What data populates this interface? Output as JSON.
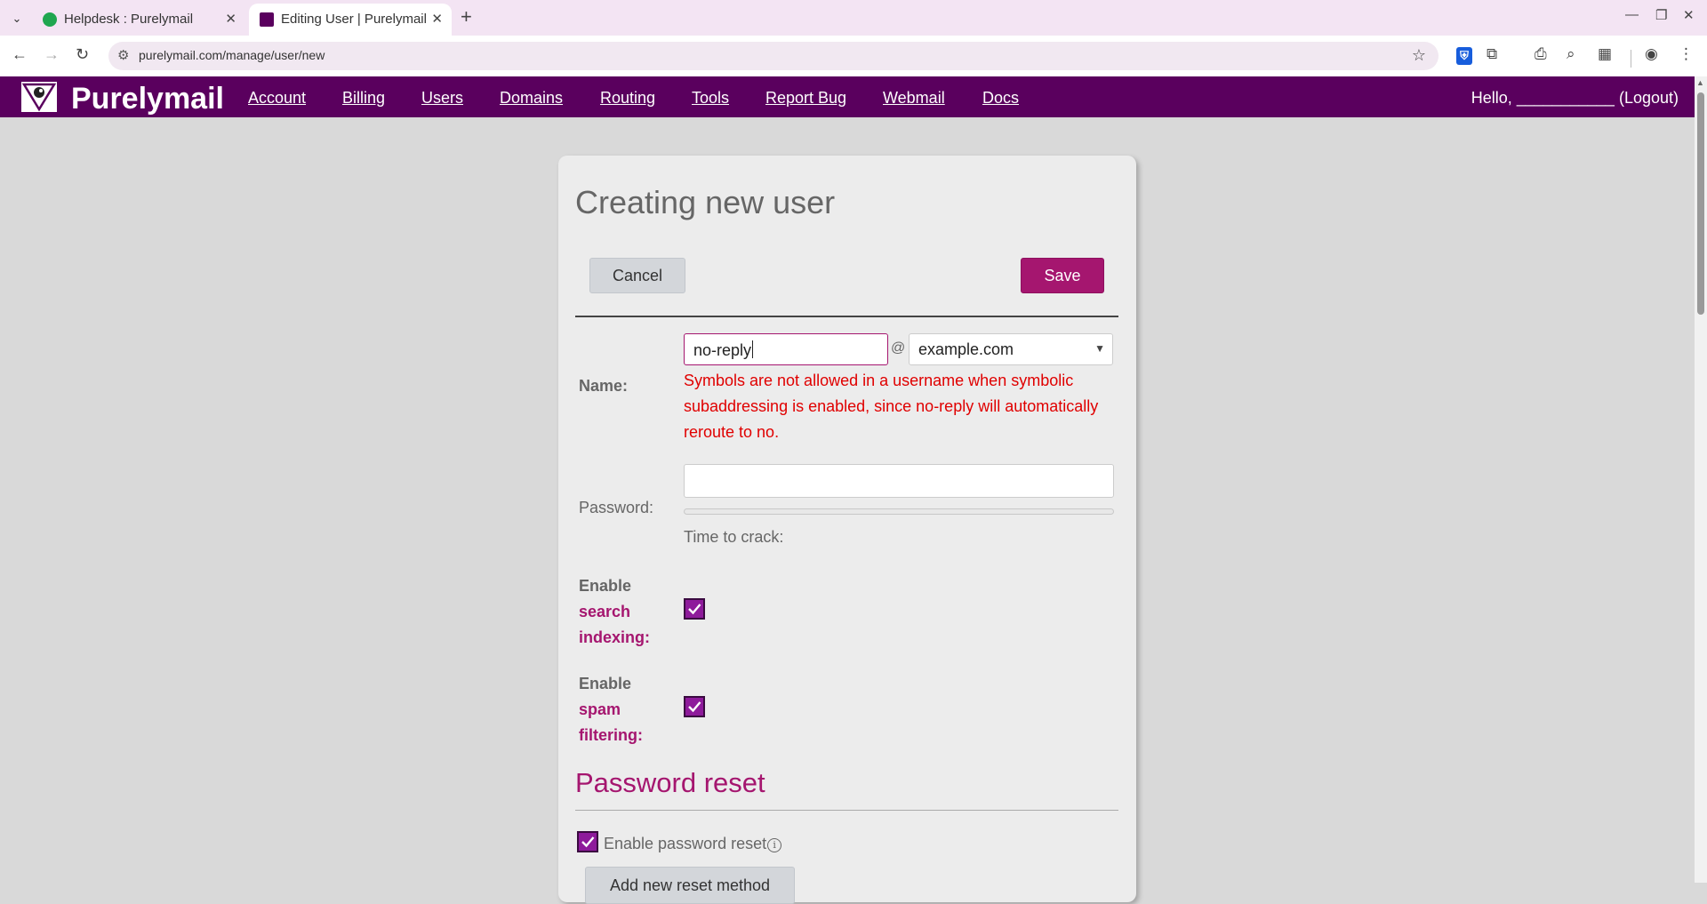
{
  "browser": {
    "tabs": [
      {
        "title": "Helpdesk : Purelymail",
        "active": false
      },
      {
        "title": "Editing User | Purelymail",
        "active": true
      }
    ],
    "url": "purelymail.com/manage/user/new"
  },
  "site": {
    "brand": "Purelymail",
    "nav": [
      "Account",
      "Billing",
      "Users",
      "Domains",
      "Routing",
      "Tools",
      "Report Bug",
      "Webmail",
      "Docs"
    ],
    "greeting": "Hello,",
    "username_blank": "___________",
    "logout": "(Logout)",
    "colors": {
      "header_bg": "#5a005e",
      "accent": "#a5166f",
      "error": "#e00000"
    }
  },
  "form": {
    "title": "Creating new user",
    "cancel_label": "Cancel",
    "save_label": "Save",
    "name_label": "Name:",
    "name_value": "no-reply",
    "at_sign": "@",
    "domain_value": "example.com",
    "error_message": "Symbols are not allowed in a username when symbolic subaddressing is enabled, since no-reply will automatically reroute to no.",
    "password_label": "Password:",
    "password_value": "",
    "time_to_crack_label": "Time to crack:",
    "search_indexing": {
      "label_1": "Enable",
      "label_2": "search",
      "label_3": "indexing:",
      "checked": true
    },
    "spam_filtering": {
      "label_1": "Enable",
      "label_2": "spam",
      "label_3": "filtering:",
      "checked": true
    }
  },
  "password_reset": {
    "title": "Password reset",
    "enable_label": "Enable password reset",
    "enabled": true,
    "info_icon": "ⓘ",
    "add_method_label": "Add new reset method"
  }
}
